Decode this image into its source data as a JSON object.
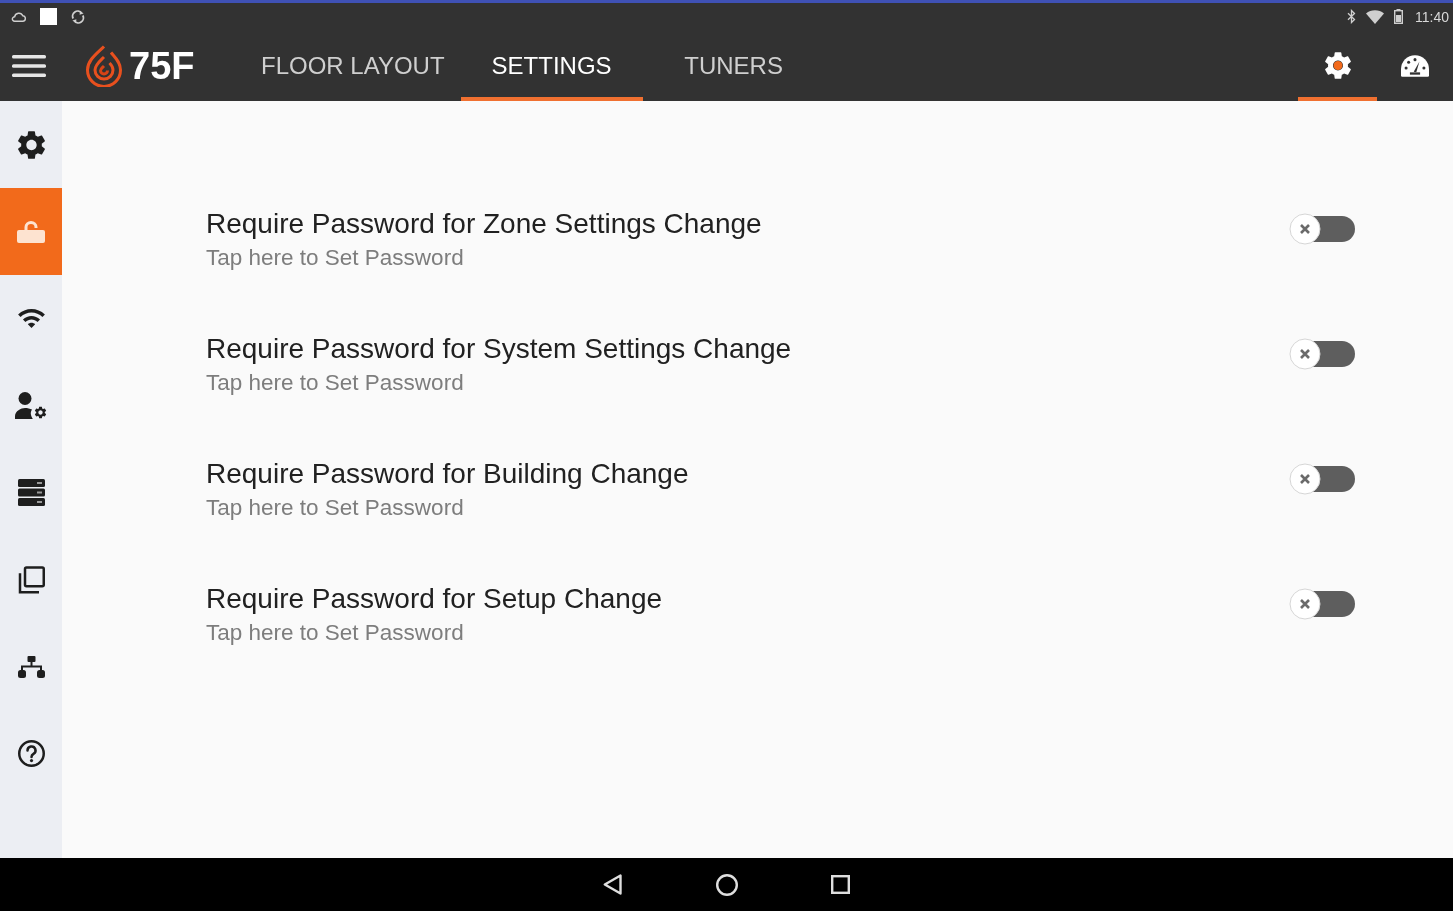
{
  "status_bar": {
    "time": "11:40"
  },
  "app_bar": {
    "logo_text": "75F",
    "tabs": [
      {
        "label": "FLOOR LAYOUT",
        "selected": false
      },
      {
        "label": "SETTINGS",
        "selected": true
      },
      {
        "label": "TUNERS",
        "selected": false
      }
    ],
    "actions": [
      {
        "kind": "settings",
        "selected": true
      },
      {
        "kind": "dashboard",
        "selected": false
      }
    ]
  },
  "sidebar": {
    "items": [
      {
        "kind": "settings",
        "selected": false
      },
      {
        "kind": "security",
        "selected": true
      },
      {
        "kind": "wifi",
        "selected": false
      },
      {
        "kind": "user_settings",
        "selected": false
      },
      {
        "kind": "server",
        "selected": false
      },
      {
        "kind": "copy",
        "selected": false
      },
      {
        "kind": "network",
        "selected": false
      },
      {
        "kind": "help",
        "selected": false
      }
    ]
  },
  "settings": [
    {
      "title": "Require Password for Zone Settings Change",
      "subtitle": "Tap here to Set Password",
      "on": false
    },
    {
      "title": "Require Password for System Settings Change",
      "subtitle": "Tap here to Set Password",
      "on": false
    },
    {
      "title": "Require Password for Building Change",
      "subtitle": "Tap here to Set Password",
      "on": false
    },
    {
      "title": "Require Password for Setup Change",
      "subtitle": "Tap here to Set Password",
      "on": false
    }
  ]
}
